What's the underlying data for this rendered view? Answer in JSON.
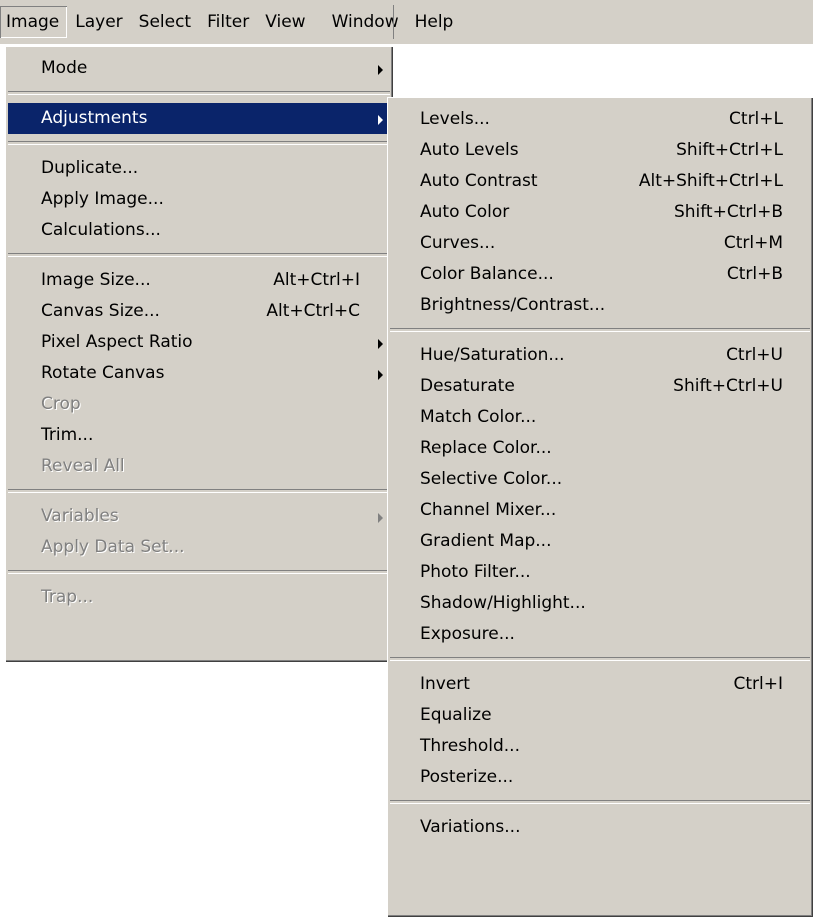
{
  "menubar": [
    "Image",
    "Layer",
    "Select",
    "Filter",
    "View",
    "Window",
    "Help"
  ],
  "image_menu": {
    "mode": "Mode",
    "adjustments": "Adjustments",
    "duplicate": "Duplicate...",
    "apply_image": "Apply Image...",
    "calculations": "Calculations...",
    "image_size": "Image Size...",
    "image_size_shortcut": "Alt+Ctrl+I",
    "canvas_size": "Canvas Size...",
    "canvas_size_shortcut": "Alt+Ctrl+C",
    "pixel_aspect_ratio": "Pixel Aspect Ratio",
    "rotate_canvas": "Rotate Canvas",
    "crop": "Crop",
    "trim": "Trim...",
    "reveal_all": "Reveal All",
    "variables": "Variables",
    "apply_data_set": "Apply Data Set...",
    "trap": "Trap..."
  },
  "adjustments_menu": [
    {
      "label": "Levels...",
      "shortcut": "Ctrl+L"
    },
    {
      "label": "Auto Levels",
      "shortcut": "Shift+Ctrl+L"
    },
    {
      "label": "Auto Contrast",
      "shortcut": "Alt+Shift+Ctrl+L"
    },
    {
      "label": "Auto Color",
      "shortcut": "Shift+Ctrl+B"
    },
    {
      "label": "Curves...",
      "shortcut": "Ctrl+M"
    },
    {
      "label": "Color Balance...",
      "shortcut": "Ctrl+B"
    },
    {
      "label": "Brightness/Contrast...",
      "shortcut": ""
    },
    {
      "label": "Hue/Saturation...",
      "shortcut": "Ctrl+U"
    },
    {
      "label": "Desaturate",
      "shortcut": "Shift+Ctrl+U"
    },
    {
      "label": "Match Color...",
      "shortcut": ""
    },
    {
      "label": "Replace Color...",
      "shortcut": ""
    },
    {
      "label": "Selective Color...",
      "shortcut": ""
    },
    {
      "label": "Channel Mixer...",
      "shortcut": ""
    },
    {
      "label": "Gradient Map...",
      "shortcut": ""
    },
    {
      "label": "Photo Filter...",
      "shortcut": ""
    },
    {
      "label": "Shadow/Highlight...",
      "shortcut": ""
    },
    {
      "label": "Exposure...",
      "shortcut": ""
    },
    {
      "label": "Invert",
      "shortcut": "Ctrl+I"
    },
    {
      "label": "Equalize",
      "shortcut": ""
    },
    {
      "label": "Threshold...",
      "shortcut": ""
    },
    {
      "label": "Posterize...",
      "shortcut": ""
    },
    {
      "label": "Variations...",
      "shortcut": ""
    }
  ],
  "colors": {
    "menu_bg": "#d4d0c8",
    "highlight_bg": "#0a246a",
    "highlight_text": "#ffffff",
    "disabled_text": "#808080"
  }
}
